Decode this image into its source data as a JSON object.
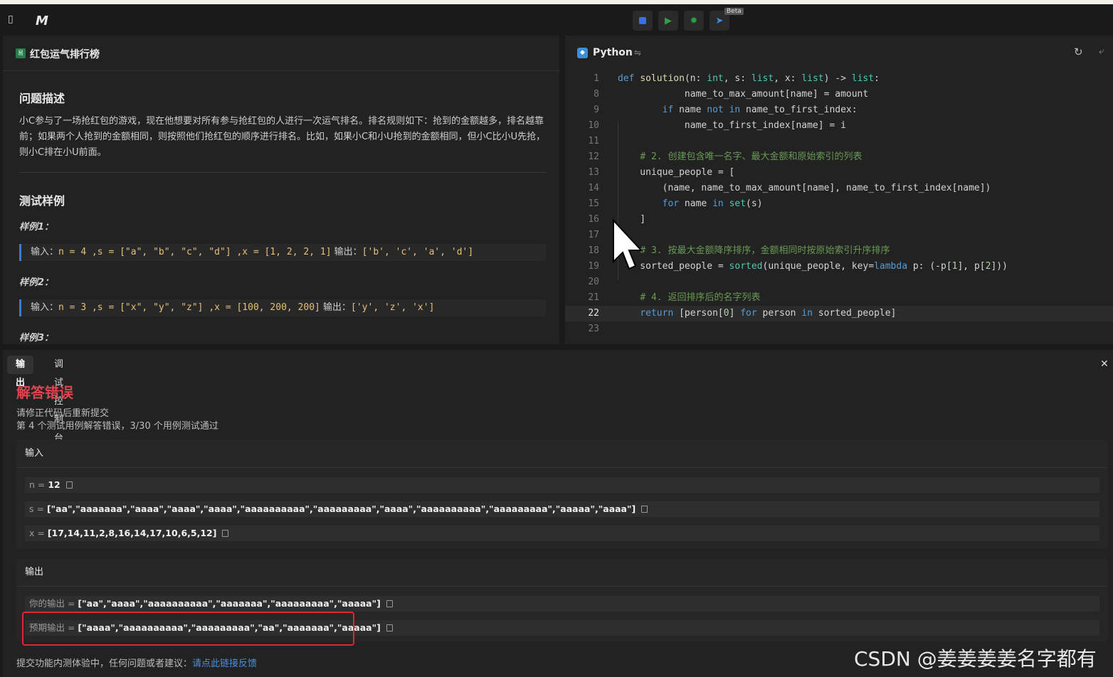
{
  "toolbar": {
    "sidebar_icon": "sidebar-toggle-icon",
    "logo": "M",
    "buttons": [
      "stop-icon",
      "run-icon",
      "debug-icon",
      "submit-icon"
    ],
    "beta_label": "Beta"
  },
  "problem": {
    "title": "红包运气排行榜",
    "desc_heading": "问题描述",
    "description": "小C参与了一场抢红包的游戏，现在他想要对所有参与抢红包的人进行一次运气排名。排名规则如下：抢到的金额越多，排名越靠前；如果两个人抢到的金额相同，则按照他们抢红包的顺序进行排名。比如，如果小C和小U抢到的金额相同，但小C比小U先抢，则小C排在小U前面。",
    "samples_heading": "测试样例",
    "samples": [
      {
        "label": "样例1：",
        "input_prefix": "输入：",
        "input_code": "n = 4 ,s = [\"a\", \"b\", \"c\", \"d\"] ,x = [1, 2, 2, 1]",
        "output_prefix": " 输出：",
        "output_code": "['b', 'c', 'a', 'd']"
      },
      {
        "label": "样例2：",
        "input_prefix": "输入：",
        "input_code": "n = 3 ,s = [\"x\", \"y\", \"z\"] ,x = [100, 200, 200]",
        "output_prefix": " 输出：",
        "output_code": "['y', 'z', 'x']"
      },
      {
        "label": "样例3："
      }
    ]
  },
  "editor": {
    "language": "Python",
    "lines": [
      {
        "n": "1",
        "text": "def solution(n: int, s: list, x: list) -> list:"
      },
      {
        "n": "8",
        "text": "            name_to_max_amount[name] = amount"
      },
      {
        "n": "9",
        "text": "        if name not in name_to_first_index:"
      },
      {
        "n": "10",
        "text": "            name_to_first_index[name] = i"
      },
      {
        "n": "11",
        "text": ""
      },
      {
        "n": "12",
        "text": "    # 2. 创建包含唯一名字、最大金额和原始索引的列表"
      },
      {
        "n": "13",
        "text": "    unique_people = ["
      },
      {
        "n": "14",
        "text": "        (name, name_to_max_amount[name], name_to_first_index[name])"
      },
      {
        "n": "15",
        "text": "        for name in set(s)"
      },
      {
        "n": "16",
        "text": "    ]"
      },
      {
        "n": "17",
        "text": ""
      },
      {
        "n": "18",
        "text": "    # 3. 按最大金额降序排序，金额相同时按原始索引升序排序"
      },
      {
        "n": "19",
        "text": "    sorted_people = sorted(unique_people, key=lambda p: (-p[1], p[2]))"
      },
      {
        "n": "20",
        "text": ""
      },
      {
        "n": "21",
        "text": "    # 4. 返回排序后的名字列表"
      },
      {
        "n": "22",
        "text": "    return [person[0] for person in sorted_people]"
      },
      {
        "n": "23",
        "text": ""
      }
    ]
  },
  "result": {
    "tabs": [
      "输出",
      "调试控制台"
    ],
    "verdict": "解答错误",
    "hint": "请修正代码后重新提交",
    "summary": "第 4 个测试用例解答错误，3/30 个用例测试通过",
    "input_heading": "输入",
    "inputs": [
      {
        "key": "n = ",
        "value": "12"
      },
      {
        "key": "s = ",
        "value": "[\"aa\",\"aaaaaaa\",\"aaaa\",\"aaaa\",\"aaaa\",\"aaaaaaaaaa\",\"aaaaaaaaa\",\"aaaa\",\"aaaaaaaaaa\",\"aaaaaaaaa\",\"aaaaa\",\"aaaa\"]"
      },
      {
        "key": "x = ",
        "value": "[17,14,11,2,8,16,14,17,10,6,5,12]"
      }
    ],
    "output_heading": "输出",
    "your_output_key": "你的输出 = ",
    "your_output": "[\"aa\",\"aaaa\",\"aaaaaaaaaa\",\"aaaaaaa\",\"aaaaaaaaa\",\"aaaaa\"]",
    "expected_key": "预期输出 = ",
    "expected_output": "[\"aaaa\",\"aaaaaaaaaa\",\"aaaaaaaaa\",\"aa\",\"aaaaaaa\",\"aaaaa\"]",
    "footer_text": "提交功能内测体验中，任何问题或者建议：",
    "footer_link": "请点此链接反馈"
  },
  "watermark": "CSDN @姜姜姜姜名字都有",
  "colors": {
    "error": "#e2434f",
    "accent": "#3a7bd5",
    "highlight_box": "#e0262f"
  }
}
